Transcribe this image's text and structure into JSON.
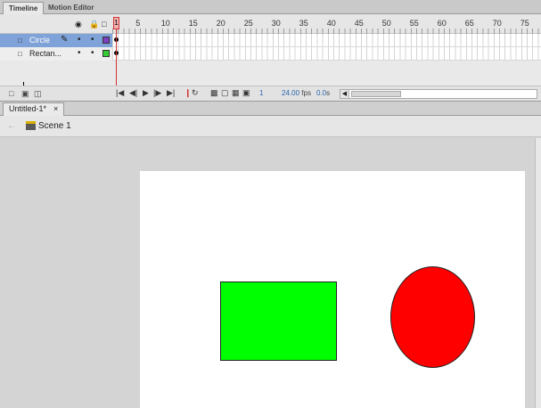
{
  "panel_tabs": [
    {
      "label": "Timeline"
    },
    {
      "label": "Motion Editor"
    }
  ],
  "timeline": {
    "header_icons": {
      "eye": "eye-icon",
      "lock": "lock-icon",
      "outline": "outline-icon"
    },
    "ruler_numbers": [
      "5",
      "10",
      "15",
      "20",
      "25",
      "30",
      "35",
      "40",
      "45",
      "50",
      "55",
      "60",
      "65",
      "70",
      "75"
    ],
    "current_frame_marker": "1",
    "layers": [
      {
        "name": "Circle",
        "selected": true,
        "color": "#7b3fbf"
      },
      {
        "name": "Rectan...",
        "selected": false,
        "color": "#33cc33"
      }
    ],
    "bottom": {
      "frame_number": "1",
      "fps": "24.00",
      "fps_unit": "fps",
      "time": "0.0",
      "time_unit": "s"
    }
  },
  "document": {
    "tab_label": "Untitled-1*",
    "close": "×",
    "scene_label": "Scene 1"
  },
  "stage": {
    "background": "#ffffff",
    "rectangle_color": "#00ff00",
    "circle_color": "#ff0000"
  }
}
